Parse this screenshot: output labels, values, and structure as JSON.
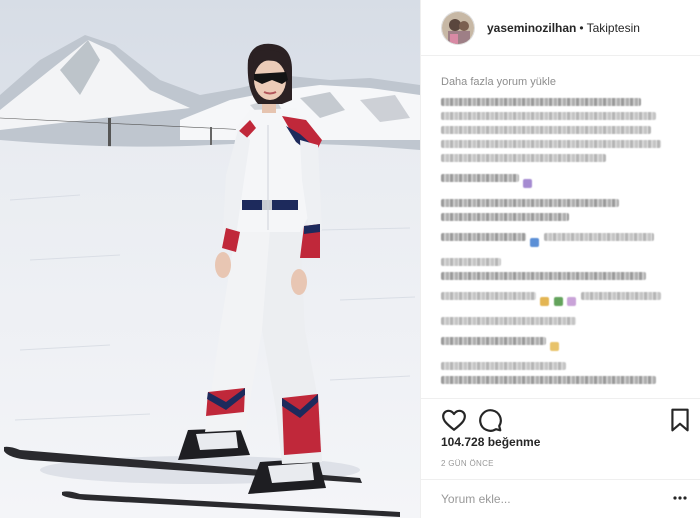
{
  "post": {
    "username": "yaseminozilhan",
    "separator": "•",
    "follow_state": "Takiptesin"
  },
  "comments": {
    "load_more": "Daha fazla yorum yükle"
  },
  "actions": {
    "like_icon": "heart-icon",
    "comment_icon": "speech-bubble-icon",
    "save_icon": "bookmark-icon",
    "likes_count": "104.728 beğenme",
    "timestamp": "2 GÜN ÖNCE"
  },
  "comment_box": {
    "placeholder": "Yorum ekle...",
    "menu_icon": "more-options-icon"
  },
  "colors": {
    "text": "#262626",
    "muted": "#999999",
    "border": "#efefef",
    "suit_red": "#c0283a",
    "suit_navy": "#1d2a5c"
  }
}
